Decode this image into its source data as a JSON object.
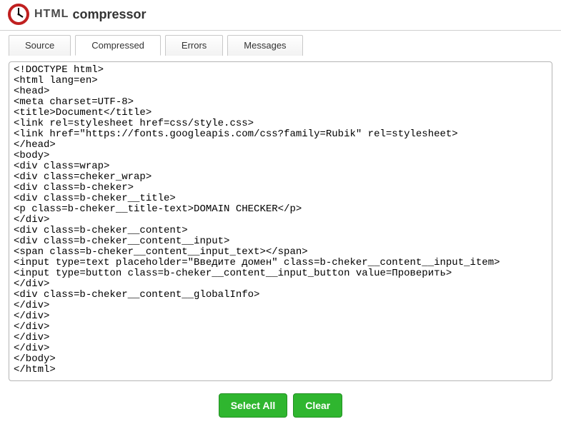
{
  "logo": {
    "mark": "HTML",
    "word": "compressor"
  },
  "tabs": {
    "source": "Source",
    "compressed": "Compressed",
    "errors": "Errors",
    "messages": "Messages"
  },
  "active_tab": "compressed",
  "buttons": {
    "select_all": "Select All",
    "clear": "Clear"
  },
  "code_output": "<!DOCTYPE html>\n<html lang=en>\n<head>\n<meta charset=UTF-8>\n<title>Document</title>\n<link rel=stylesheet href=css/style.css>\n<link href=\"https://fonts.googleapis.com/css?family=Rubik\" rel=stylesheet>\n</head>\n<body>\n<div class=wrap>\n<div class=cheker_wrap>\n<div class=b-cheker>\n<div class=b-cheker__title>\n<p class=b-cheker__title-text>DOMAIN CHECKER</p>\n</div>\n<div class=b-cheker__content>\n<div class=b-cheker__content__input>\n<span class=b-cheker__content__input_text></span>\n<input type=text placeholder=\"Введите домен\" class=b-cheker__content__input_item>\n<input type=button class=b-cheker__content__input_button value=Проверить>\n</div>\n<div class=b-cheker__content__globalInfo>\n</div>\n</div>\n</div>\n</div>\n</div>\n</body>\n</html>"
}
